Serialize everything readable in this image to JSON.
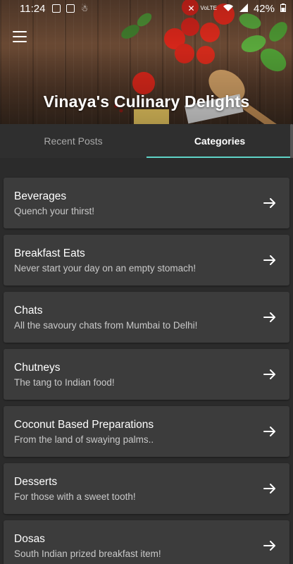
{
  "status_bar": {
    "time": "11:24",
    "network": "VoLTE",
    "battery": "42%"
  },
  "header": {
    "title": "Vinaya's Culinary Delights",
    "menu_icon": "hamburger-menu-icon"
  },
  "tabs": [
    {
      "label": "Recent Posts",
      "active": false
    },
    {
      "label": "Categories",
      "active": true
    }
  ],
  "accent_color": "#5fd3c7",
  "categories": [
    {
      "title": "Beverages",
      "subtitle": "Quench your thirst!"
    },
    {
      "title": "Breakfast Eats",
      "subtitle": "Never start your day on an empty stomach!"
    },
    {
      "title": "Chats",
      "subtitle": "All the savoury chats from Mumbai to Delhi!"
    },
    {
      "title": "Chutneys",
      "subtitle": "The tang to Indian food!"
    },
    {
      "title": "Coconut Based Preparations",
      "subtitle": "From the land of swaying palms.."
    },
    {
      "title": "Desserts",
      "subtitle": "For those with a sweet tooth!"
    },
    {
      "title": "Dosas",
      "subtitle": "South Indian prized breakfast item!"
    }
  ]
}
